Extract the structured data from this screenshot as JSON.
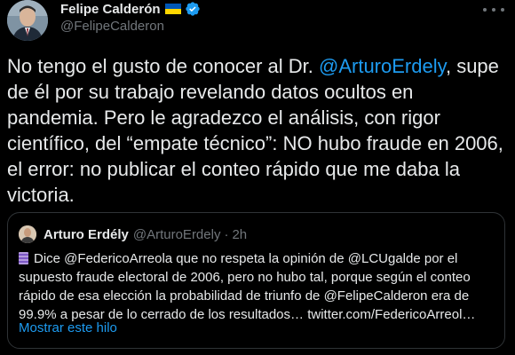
{
  "author": {
    "display_name": "Felipe Calderón",
    "handle": "@FelipeCalderon",
    "flag_icon": "ukraine-flag-icon",
    "verified_icon": "verified-badge-icon",
    "verified_color": "#1d9bf0"
  },
  "tweet": {
    "text_part1": "No tengo el gusto de conocer al Dr. ",
    "mention": "@ArturoErdely",
    "text_part2": ", supe de él por su trabajo revelando datos ocultos en pandemia. Pero le agradezco el análisis, con rigor científico, del “empate técnico”: NO hubo fraude en 2006, el error: no publicar el conteo rápido que me daba la victoria."
  },
  "quoted": {
    "display_name": "Arturo Erdély",
    "handle": "@ArturoErdely",
    "separator": "·",
    "time": "2h",
    "thread_icon": "thread-spool-icon",
    "text": "Dice @FedericoArreola que no respeta la opinión de @LCUgalde por el supuesto fraude electoral de 2006, pero no hubo tal, porque según el conteo rápido de esa elección la probabilidad de triunfo de @FelipeCalderon era de 99.9% a pesar de lo cerrado de los resultados… twitter.com/FedericoArreol…",
    "show_thread": "Mostrar este hilo"
  },
  "colors": {
    "background": "#000000",
    "text": "#e7e9ea",
    "secondary": "#71767b",
    "link": "#1d9bf0",
    "border": "#2f3336"
  }
}
